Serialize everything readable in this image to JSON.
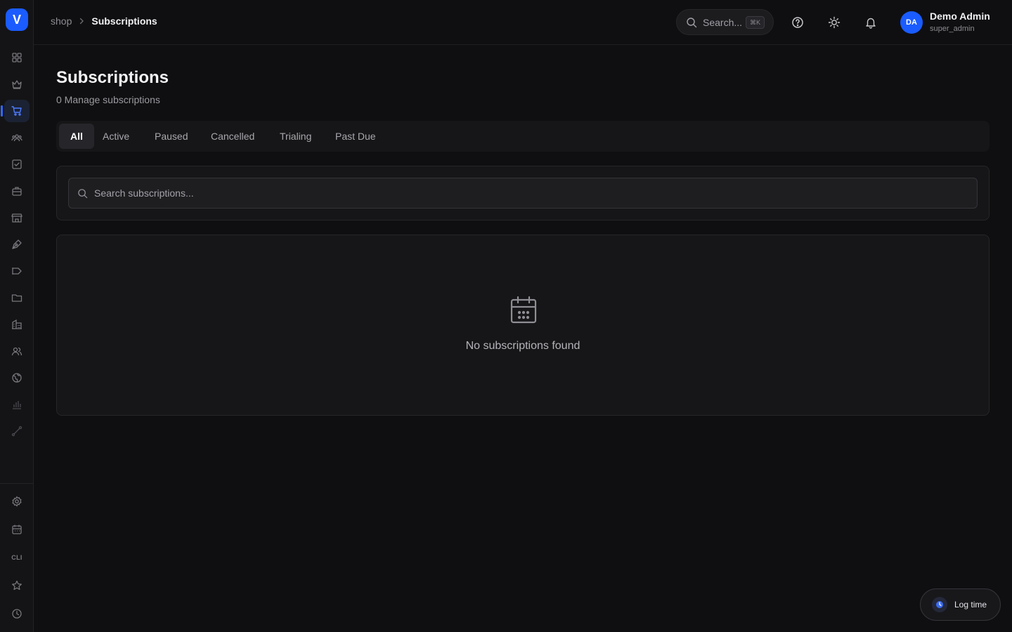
{
  "app": {
    "logo_letter": "V",
    "accent": "#1a5cff"
  },
  "sidebar": {
    "items": [
      {
        "icon": "grid-icon"
      },
      {
        "icon": "crown-icon"
      },
      {
        "icon": "cart-icon",
        "active": true
      },
      {
        "icon": "users-group-icon"
      },
      {
        "icon": "checkbox-icon"
      },
      {
        "icon": "briefcase-icon"
      },
      {
        "icon": "store-icon"
      },
      {
        "icon": "pen-nib-icon"
      },
      {
        "icon": "megaphone-icon"
      },
      {
        "icon": "folder-icon"
      },
      {
        "icon": "building-icon"
      },
      {
        "icon": "contacts-icon"
      },
      {
        "icon": "globe-icon"
      },
      {
        "icon": "bar-chart-icon"
      },
      {
        "icon": "route-icon"
      }
    ],
    "bottom": [
      {
        "icon": "settings-icon"
      },
      {
        "icon": "calendar-clock-icon"
      },
      {
        "label": "CLI"
      },
      {
        "icon": "star-icon"
      },
      {
        "icon": "clock-icon"
      }
    ]
  },
  "header": {
    "breadcrumb": [
      "shop",
      "Subscriptions"
    ],
    "search_label": "Search...",
    "search_shortcut": "⌘K",
    "user": {
      "initials": "DA",
      "name": "Demo Admin",
      "role": "super_admin"
    }
  },
  "main": {
    "title": "Subscriptions",
    "subtitle": "0 Manage subscriptions",
    "tabs": [
      {
        "label": "All",
        "active": true
      },
      {
        "label": "Active"
      },
      {
        "label": "Paused"
      },
      {
        "label": "Cancelled"
      },
      {
        "label": "Trialing"
      },
      {
        "label": "Past Due"
      }
    ],
    "search": {
      "placeholder": "Search subscriptions...",
      "value": ""
    },
    "empty_state": {
      "icon": "calendar-icon",
      "message": "No subscriptions found"
    }
  },
  "floating": {
    "log_time_label": "Log time"
  }
}
